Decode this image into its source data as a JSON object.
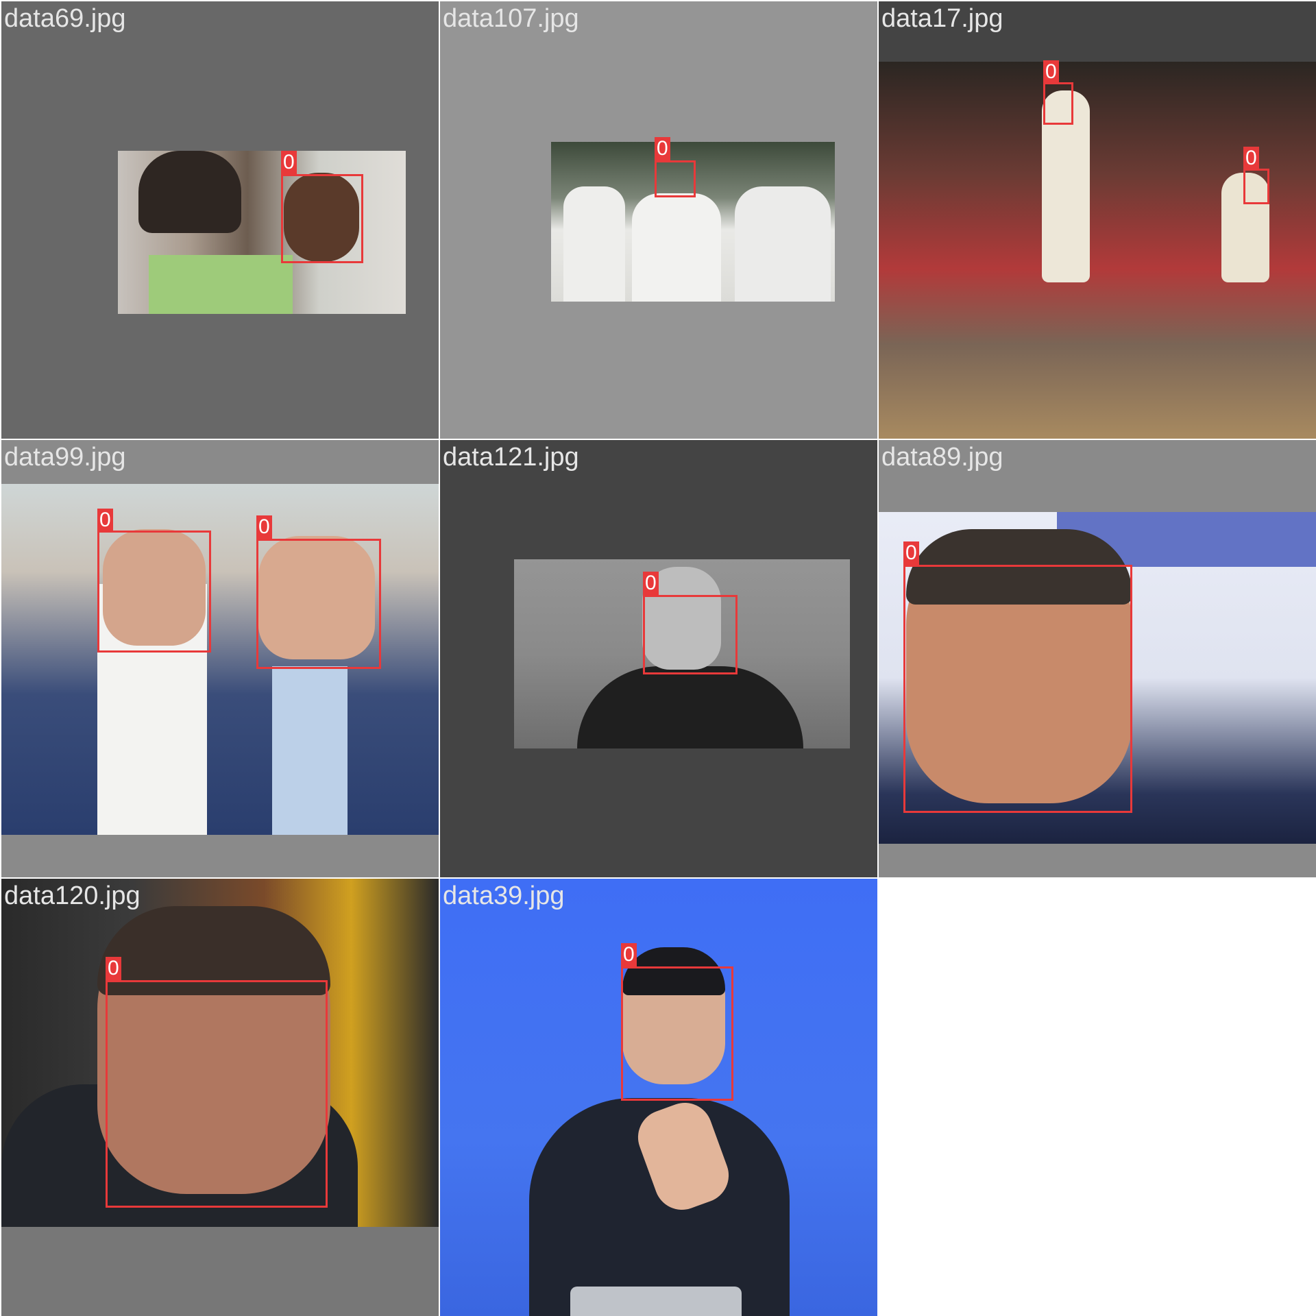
{
  "tiles": [
    {
      "filename": "data69.jpg",
      "boxes": [
        {
          "label": "0"
        }
      ]
    },
    {
      "filename": "data107.jpg",
      "boxes": [
        {
          "label": "0"
        }
      ]
    },
    {
      "filename": "data17.jpg",
      "boxes": [
        {
          "label": "0"
        },
        {
          "label": "0"
        }
      ]
    },
    {
      "filename": "data99.jpg",
      "boxes": [
        {
          "label": "0"
        },
        {
          "label": "0"
        }
      ]
    },
    {
      "filename": "data121.jpg",
      "boxes": [
        {
          "label": "0"
        }
      ]
    },
    {
      "filename": "data89.jpg",
      "boxes": [
        {
          "label": "0"
        }
      ]
    },
    {
      "filename": "data120.jpg",
      "boxes": [
        {
          "label": "0"
        }
      ]
    },
    {
      "filename": "data39.jpg",
      "boxes": [
        {
          "label": "0"
        }
      ]
    }
  ],
  "colors": {
    "box": "#e8393a",
    "filename_text": "#e6e6e6",
    "page_background": "#ffffff"
  }
}
